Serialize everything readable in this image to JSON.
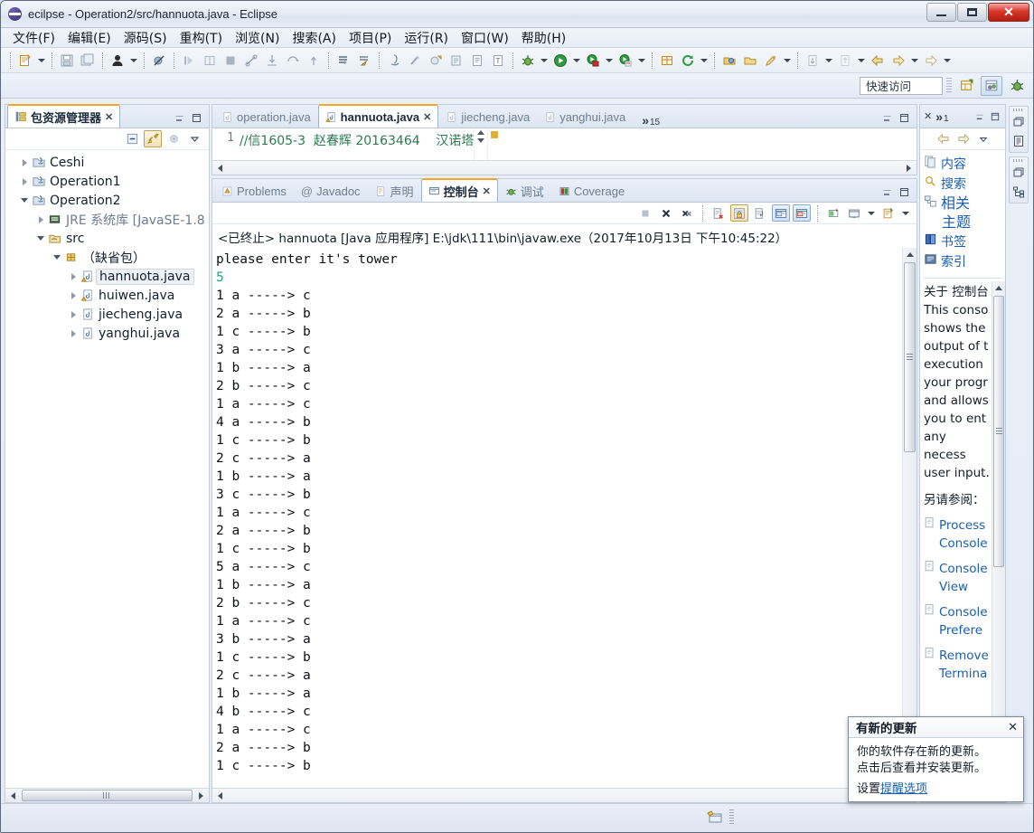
{
  "window": {
    "title": "ecilpse - Operation2/src/hannuota.java - Eclipse",
    "minimize_label": "最小化",
    "maximize_label": "最大化",
    "close_label": "✕"
  },
  "menubar": {
    "items": [
      {
        "label": "文件(F)",
        "name": "menu-file"
      },
      {
        "label": "编辑(E)",
        "name": "menu-edit"
      },
      {
        "label": "源码(S)",
        "name": "menu-source"
      },
      {
        "label": "重构(T)",
        "name": "menu-refactor"
      },
      {
        "label": "浏览(N)",
        "name": "menu-navigate"
      },
      {
        "label": "搜索(A)",
        "name": "menu-search"
      },
      {
        "label": "项目(P)",
        "name": "menu-project"
      },
      {
        "label": "运行(R)",
        "name": "menu-run"
      },
      {
        "label": "窗口(W)",
        "name": "menu-window"
      },
      {
        "label": "帮助(H)",
        "name": "menu-help"
      }
    ]
  },
  "quick_access": {
    "placeholder": "快速访问",
    "value": "快速访问"
  },
  "explorer": {
    "tab_label": "包资源管理器",
    "close_label": "✕",
    "toolbar": {
      "collapse_all": "collapse-all-icon",
      "link_with_editor": "link-with-editor-icon",
      "focus_on_active": "focus-active-task-icon",
      "view_menu": "view-menu-icon"
    },
    "tree": [
      {
        "label": "Ceshi",
        "depth": 0,
        "state": "closed",
        "icon": "java-project-icon",
        "selected": false
      },
      {
        "label": "Operation1",
        "depth": 0,
        "state": "closed",
        "icon": "java-project-icon",
        "selected": false
      },
      {
        "label": "Operation2",
        "depth": 0,
        "state": "open",
        "icon": "java-project-icon",
        "selected": false
      },
      {
        "label": "JRE 系统库 [JavaSE-1.8",
        "depth": 1,
        "state": "closed",
        "icon": "jre-library-icon",
        "selected": false
      },
      {
        "label": "src",
        "depth": 1,
        "state": "open",
        "icon": "source-folder-icon",
        "selected": false
      },
      {
        "label": "（缺省包）",
        "depth": 2,
        "state": "open",
        "icon": "package-icon",
        "selected": false
      },
      {
        "label": "hannuota.java",
        "depth": 3,
        "state": "closed",
        "icon": "java-file-warning-icon",
        "selected": true
      },
      {
        "label": "huiwen.java",
        "depth": 3,
        "state": "closed",
        "icon": "java-file-warning-icon",
        "selected": false
      },
      {
        "label": "jiecheng.java",
        "depth": 3,
        "state": "closed",
        "icon": "java-file-icon",
        "selected": false
      },
      {
        "label": "yanghui.java",
        "depth": 3,
        "state": "closed",
        "icon": "java-file-icon",
        "selected": false
      }
    ]
  },
  "editor": {
    "tabs": [
      {
        "label": "operation.java",
        "active": false,
        "closable": false
      },
      {
        "label": "hannuota.java",
        "active": true,
        "closable": true
      },
      {
        "label": "jiecheng.java",
        "active": false,
        "closable": false
      },
      {
        "label": "yanghui.java",
        "active": false,
        "closable": false
      }
    ],
    "overflow_chevron": "»",
    "overflow_count": "15",
    "minimize_label": "最小化",
    "maximize_label": "最大化",
    "lines": [
      {
        "number": "1",
        "text": "//信1605-3  赵春辉 20163464    汉诺塔"
      }
    ]
  },
  "console_panel": {
    "tabs": [
      {
        "label": "Problems",
        "icon": "problems-icon",
        "active": false
      },
      {
        "label": "Javadoc",
        "icon": "javadoc-icon",
        "active": false
      },
      {
        "label": "声明",
        "icon": "declaration-icon",
        "active": false
      },
      {
        "label": "控制台",
        "icon": "console-icon",
        "active": true
      },
      {
        "label": "调试",
        "icon": "debug-icon",
        "active": false
      },
      {
        "label": "Coverage",
        "icon": "coverage-icon",
        "active": false
      }
    ],
    "toolbar": [
      {
        "name": "terminate-button",
        "icon": "stop-square-icon",
        "enabled": false
      },
      {
        "name": "remove-launch-button",
        "icon": "remove-x-icon",
        "enabled": true
      },
      {
        "name": "remove-all-terminated-button",
        "icon": "remove-all-xx-icon",
        "enabled": true
      },
      {
        "name": "clear-console-button",
        "icon": "clear-console-icon",
        "enabled": true
      },
      {
        "name": "scroll-lock-button",
        "icon": "scroll-lock-icon",
        "toggled": true
      },
      {
        "name": "word-wrap-button",
        "icon": "word-wrap-icon",
        "enabled": true
      },
      {
        "name": "show-console-on-output-button",
        "icon": "show-console-output-icon",
        "toggled": true
      },
      {
        "name": "show-console-on-error-button",
        "icon": "show-console-error-icon",
        "toggled": true
      },
      {
        "name": "pin-console-button",
        "icon": "pin-console-icon",
        "enabled": true
      },
      {
        "name": "display-selected-console-button",
        "icon": "display-console-icon",
        "enabled": true
      },
      {
        "name": "display-selected-console-menu",
        "icon": "chevron-down-icon",
        "enabled": true
      },
      {
        "name": "open-console-button",
        "icon": "open-console-icon",
        "enabled": true
      },
      {
        "name": "open-console-menu",
        "icon": "chevron-down-icon",
        "enabled": true
      }
    ],
    "status_line": "<已终止> hannuota [Java 应用程序] E:\\jdk\\111\\bin\\javaw.exe（2017年10月13日 下午10:45:22）",
    "output_prompt": "please enter it's tower",
    "user_input": "5",
    "moves": [
      "1 a -----> c",
      "2 a -----> b",
      "1 c -----> b",
      "3 a -----> c",
      "1 b -----> a",
      "2 b -----> c",
      "1 a -----> c",
      "4 a -----> b",
      "1 c -----> b",
      "2 c -----> a",
      "1 b -----> a",
      "3 c -----> b",
      "1 a -----> c",
      "2 a -----> b",
      "1 c -----> b",
      "5 a -----> c",
      "1 b -----> a",
      "2 b -----> c",
      "1 a -----> c",
      "3 b -----> a",
      "1 c -----> b",
      "2 c -----> a",
      "1 b -----> a",
      "4 b -----> c",
      "1 a -----> c",
      "2 a -----> b",
      "1 c -----> b"
    ]
  },
  "help_panel": {
    "close_label": "✕",
    "overflow_chevron": "»",
    "overflow_count": "1",
    "minimize_label": "最小化",
    "maximize_label": "最大化",
    "nav": {
      "back": "back-arrow-icon",
      "forward": "forward-arrow-icon",
      "menu": "view-menu-icon"
    },
    "links": [
      {
        "label": "内容",
        "icon": "contents-icon",
        "big": false
      },
      {
        "label": "搜索",
        "icon": "search-icon",
        "big": false
      },
      {
        "label": "相关",
        "icon": "related-topics-icon",
        "big": true
      },
      {
        "label": "主题",
        "icon": "",
        "big": true
      },
      {
        "label": "书签",
        "icon": "bookmark-icon",
        "big": false
      },
      {
        "label": "索引",
        "icon": "index-icon",
        "big": false
      }
    ],
    "about_title": "关于 控制台",
    "about_text": "This conso shows the output of t execution your progr and allows you to ent any necess user input.",
    "see_also_label": "另请参阅：",
    "doc_links": [
      "Process Console",
      "Console View",
      "Console Prefere",
      "Remove Termina"
    ]
  },
  "fast_view_bar": {
    "groups": [
      {
        "icons": [
          "restore-icon",
          "document-outline-icon"
        ]
      },
      {
        "icons": [
          "restore-icon",
          "hierarchy-icon"
        ]
      }
    ]
  },
  "statusbar": {
    "icon": "writable-mode-icon"
  },
  "notification": {
    "title": "有新的更新",
    "close_label": "✕",
    "line1": "你的软件存在新的更新。",
    "line2": "点击后查看并安装更新。",
    "footer_prefix": "设置",
    "footer_link": "提醒选项"
  },
  "colors": {
    "accent_orange": "#f5a623",
    "link_blue": "#1b5fb0",
    "console_input_green": "#1aab7a",
    "code_comment_green": "#2a7b54",
    "close_red": "#d8372a"
  }
}
